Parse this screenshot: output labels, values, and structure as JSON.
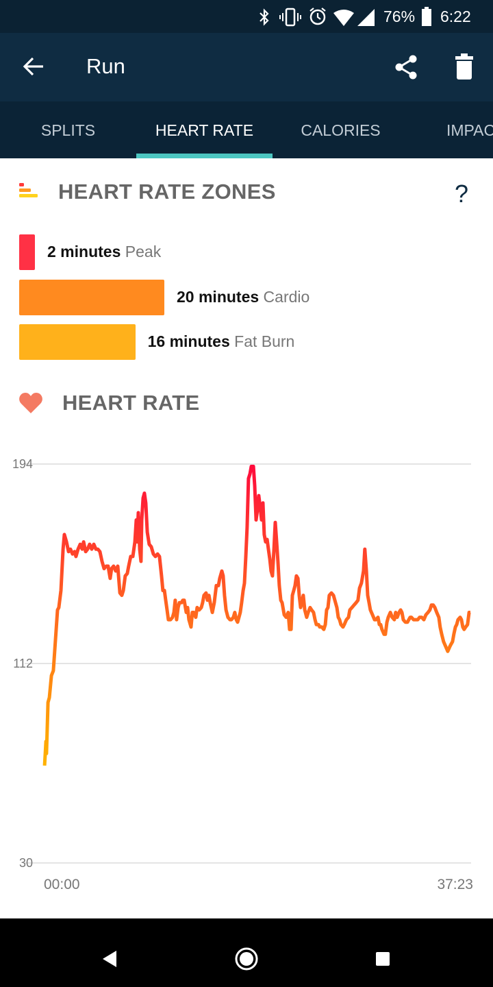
{
  "status_bar": {
    "battery": "76%",
    "time": "6:22",
    "icons": [
      "bluetooth-icon",
      "vibrate-icon",
      "alarm-icon",
      "wifi-icon",
      "signal-icon",
      "battery-icon"
    ]
  },
  "app_bar": {
    "title": "Run",
    "back_icon": "arrow-left-icon",
    "share_icon": "share-icon",
    "delete_icon": "trash-icon"
  },
  "tabs": [
    {
      "label": "SPLITS"
    },
    {
      "label": "HEART RATE",
      "active": true
    },
    {
      "label": "CALORIES"
    },
    {
      "label": "IMPAC"
    }
  ],
  "accent_color": "#4cc6c1",
  "zones": {
    "title": "HEART RATE ZONES",
    "help": "?",
    "items": [
      {
        "amount": "2 minutes",
        "name": "Peak",
        "minutes": 2,
        "color": "#ff3145"
      },
      {
        "amount": "20 minutes",
        "name": "Cardio",
        "minutes": 20,
        "color": "#ff8a1f"
      },
      {
        "amount": "16 minutes",
        "name": "Fat Burn",
        "minutes": 16,
        "color": "#ffb11b"
      }
    ]
  },
  "heart_rate": {
    "title": "HEART RATE"
  },
  "chart_data": {
    "type": "line",
    "title": "",
    "xlabel": "",
    "ylabel": "",
    "x_unit": "seconds",
    "x_tick_labels": [
      "00:00",
      "37:23"
    ],
    "xlim": [
      0,
      2243
    ],
    "y_ticks": [
      30,
      112,
      194
    ],
    "ylim": [
      30,
      194
    ],
    "grid": "horizontal",
    "gradient_colors": [
      "#ffb400",
      "#ff6a1e",
      "#ff0a3c"
    ],
    "points": [
      [
        4,
        70
      ],
      [
        11,
        80
      ],
      [
        14,
        75
      ],
      [
        22,
        96
      ],
      [
        29,
        98
      ],
      [
        40,
        107
      ],
      [
        50,
        109
      ],
      [
        58,
        118
      ],
      [
        72,
        134
      ],
      [
        79,
        135
      ],
      [
        90,
        142
      ],
      [
        101,
        159
      ],
      [
        108,
        165
      ],
      [
        119,
        162
      ],
      [
        130,
        158
      ],
      [
        140,
        159
      ],
      [
        151,
        157
      ],
      [
        162,
        158
      ],
      [
        169,
        156
      ],
      [
        180,
        159
      ],
      [
        191,
        161
      ],
      [
        202,
        159
      ],
      [
        209,
        162
      ],
      [
        220,
        158
      ],
      [
        230,
        159
      ],
      [
        241,
        161
      ],
      [
        252,
        159
      ],
      [
        263,
        161
      ],
      [
        274,
        159
      ],
      [
        284,
        159
      ],
      [
        295,
        158
      ],
      [
        306,
        154
      ],
      [
        317,
        151
      ],
      [
        328,
        152
      ],
      [
        338,
        152
      ],
      [
        349,
        147
      ],
      [
        356,
        151
      ],
      [
        367,
        152
      ],
      [
        378,
        150
      ],
      [
        389,
        152
      ],
      [
        400,
        141
      ],
      [
        410,
        140
      ],
      [
        418,
        142
      ],
      [
        428,
        148
      ],
      [
        439,
        149
      ],
      [
        446,
        152
      ],
      [
        457,
        156
      ],
      [
        468,
        156
      ],
      [
        479,
        162
      ],
      [
        486,
        171
      ],
      [
        490,
        162
      ],
      [
        497,
        174
      ],
      [
        504,
        159
      ],
      [
        511,
        154
      ],
      [
        515,
        171
      ],
      [
        522,
        180
      ],
      [
        529,
        182
      ],
      [
        536,
        178
      ],
      [
        544,
        166
      ],
      [
        554,
        161
      ],
      [
        565,
        160
      ],
      [
        576,
        157
      ],
      [
        587,
        156
      ],
      [
        598,
        157
      ],
      [
        608,
        156
      ],
      [
        619,
        148
      ],
      [
        626,
        142
      ],
      [
        634,
        142
      ],
      [
        641,
        138
      ],
      [
        648,
        134
      ],
      [
        655,
        130
      ],
      [
        666,
        130
      ],
      [
        677,
        131
      ],
      [
        684,
        133
      ],
      [
        691,
        138
      ],
      [
        698,
        130
      ],
      [
        706,
        135
      ],
      [
        713,
        137
      ],
      [
        724,
        137
      ],
      [
        731,
        138
      ],
      [
        738,
        138
      ],
      [
        749,
        133
      ],
      [
        756,
        135
      ],
      [
        763,
        130
      ],
      [
        774,
        127
      ],
      [
        781,
        133
      ],
      [
        788,
        133
      ],
      [
        799,
        131
      ],
      [
        806,
        135
      ],
      [
        817,
        134
      ],
      [
        828,
        135
      ],
      [
        835,
        137
      ],
      [
        842,
        140
      ],
      [
        853,
        141
      ],
      [
        860,
        138
      ],
      [
        868,
        140
      ],
      [
        875,
        137
      ],
      [
        886,
        133
      ],
      [
        896,
        137
      ],
      [
        907,
        144
      ],
      [
        918,
        144
      ],
      [
        925,
        147
      ],
      [
        936,
        150
      ],
      [
        943,
        148
      ],
      [
        950,
        140
      ],
      [
        958,
        134
      ],
      [
        968,
        131
      ],
      [
        979,
        130
      ],
      [
        986,
        130
      ],
      [
        997,
        131
      ],
      [
        1004,
        133
      ],
      [
        1012,
        130
      ],
      [
        1019,
        129
      ],
      [
        1026,
        131
      ],
      [
        1033,
        133
      ],
      [
        1040,
        137
      ],
      [
        1048,
        142
      ],
      [
        1055,
        145
      ],
      [
        1062,
        156
      ],
      [
        1069,
        168
      ],
      [
        1076,
        188
      ],
      [
        1084,
        190
      ],
      [
        1091,
        193
      ],
      [
        1102,
        193
      ],
      [
        1109,
        185
      ],
      [
        1116,
        171
      ],
      [
        1123,
        175
      ],
      [
        1130,
        181
      ],
      [
        1138,
        176
      ],
      [
        1145,
        171
      ],
      [
        1152,
        178
      ],
      [
        1159,
        165
      ],
      [
        1166,
        162
      ],
      [
        1174,
        163
      ],
      [
        1181,
        159
      ],
      [
        1188,
        155
      ],
      [
        1195,
        150
      ],
      [
        1202,
        148
      ],
      [
        1210,
        159
      ],
      [
        1217,
        170
      ],
      [
        1224,
        162
      ],
      [
        1231,
        154
      ],
      [
        1238,
        144
      ],
      [
        1246,
        138
      ],
      [
        1253,
        137
      ],
      [
        1264,
        132
      ],
      [
        1274,
        131
      ],
      [
        1285,
        133
      ],
      [
        1292,
        126
      ],
      [
        1300,
        126
      ],
      [
        1307,
        140
      ],
      [
        1314,
        142
      ],
      [
        1321,
        144
      ],
      [
        1328,
        148
      ],
      [
        1336,
        147
      ],
      [
        1343,
        140
      ],
      [
        1350,
        135
      ],
      [
        1357,
        137
      ],
      [
        1364,
        140
      ],
      [
        1372,
        134
      ],
      [
        1382,
        131
      ],
      [
        1390,
        133
      ],
      [
        1400,
        135
      ],
      [
        1408,
        134
      ],
      [
        1418,
        133
      ],
      [
        1426,
        130
      ],
      [
        1433,
        128
      ],
      [
        1444,
        128
      ],
      [
        1451,
        127
      ],
      [
        1462,
        127
      ],
      [
        1472,
        126
      ],
      [
        1480,
        128
      ],
      [
        1487,
        134
      ],
      [
        1494,
        135
      ],
      [
        1501,
        140
      ],
      [
        1512,
        141
      ],
      [
        1523,
        140
      ],
      [
        1530,
        138
      ],
      [
        1541,
        135
      ],
      [
        1548,
        131
      ],
      [
        1555,
        130
      ],
      [
        1562,
        128
      ],
      [
        1573,
        127
      ],
      [
        1580,
        128
      ],
      [
        1591,
        130
      ],
      [
        1602,
        131
      ],
      [
        1609,
        134
      ],
      [
        1620,
        135
      ],
      [
        1631,
        136
      ],
      [
        1642,
        137
      ],
      [
        1652,
        138
      ],
      [
        1660,
        143
      ],
      [
        1670,
        145
      ],
      [
        1681,
        150
      ],
      [
        1688,
        159
      ],
      [
        1696,
        150
      ],
      [
        1703,
        140
      ],
      [
        1710,
        137
      ],
      [
        1717,
        134
      ],
      [
        1728,
        132
      ],
      [
        1739,
        130
      ],
      [
        1746,
        130
      ],
      [
        1757,
        131
      ],
      [
        1764,
        128
      ],
      [
        1771,
        128
      ],
      [
        1778,
        126
      ],
      [
        1789,
        124
      ],
      [
        1796,
        124
      ],
      [
        1804,
        129
      ],
      [
        1811,
        131
      ],
      [
        1822,
        133
      ],
      [
        1832,
        131
      ],
      [
        1843,
        130
      ],
      [
        1850,
        133
      ],
      [
        1858,
        131
      ],
      [
        1868,
        133
      ],
      [
        1876,
        134
      ],
      [
        1883,
        133
      ],
      [
        1890,
        130
      ],
      [
        1901,
        129
      ],
      [
        1912,
        129
      ],
      [
        1919,
        130
      ],
      [
        1926,
        131
      ],
      [
        1933,
        131
      ],
      [
        1944,
        130
      ],
      [
        1955,
        130
      ],
      [
        1966,
        130
      ],
      [
        1976,
        131
      ],
      [
        1987,
        131
      ],
      [
        1998,
        130
      ],
      [
        2009,
        132
      ],
      [
        2020,
        133
      ],
      [
        2030,
        134
      ],
      [
        2038,
        136
      ],
      [
        2048,
        136
      ],
      [
        2056,
        135
      ],
      [
        2066,
        133
      ],
      [
        2077,
        131
      ],
      [
        2084,
        127
      ],
      [
        2092,
        124
      ],
      [
        2102,
        121
      ],
      [
        2113,
        119
      ],
      [
        2124,
        117
      ],
      [
        2135,
        119
      ],
      [
        2142,
        120
      ],
      [
        2149,
        121
      ],
      [
        2156,
        124
      ],
      [
        2164,
        127
      ],
      [
        2171,
        128
      ],
      [
        2178,
        130
      ],
      [
        2189,
        131
      ],
      [
        2196,
        130
      ],
      [
        2203,
        127
      ],
      [
        2210,
        126
      ],
      [
        2218,
        127
      ],
      [
        2228,
        128
      ],
      [
        2236,
        133
      ],
      [
        2243,
        133
      ]
    ]
  },
  "nav_bar": {
    "back": "nav-back-icon",
    "home": "nav-home-icon",
    "recents": "nav-recents-icon"
  }
}
